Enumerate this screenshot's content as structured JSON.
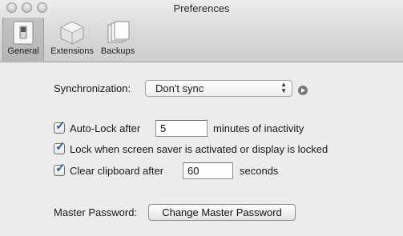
{
  "window": {
    "title": "Preferences"
  },
  "toolbar": {
    "items": [
      {
        "label": "General",
        "selected": true
      },
      {
        "label": "Extensions",
        "selected": false
      },
      {
        "label": "Backups",
        "selected": false
      }
    ]
  },
  "sync": {
    "label": "Synchronization:",
    "selected_option": "Don't sync"
  },
  "options": {
    "auto_lock": {
      "checked": true,
      "label": "Auto-Lock after",
      "value": "5",
      "suffix": "minutes of inactivity"
    },
    "lock_screensaver": {
      "checked": true,
      "label": "Lock when screen saver is activated or display is locked"
    },
    "clear_clipboard": {
      "checked": true,
      "label": "Clear clipboard after",
      "value": "60",
      "suffix": "seconds"
    }
  },
  "master_password": {
    "label": "Master Password:",
    "button_label": "Change Master Password"
  },
  "colors": {
    "checkmark": "#1b5cc8",
    "window_bg": "#ececec"
  }
}
